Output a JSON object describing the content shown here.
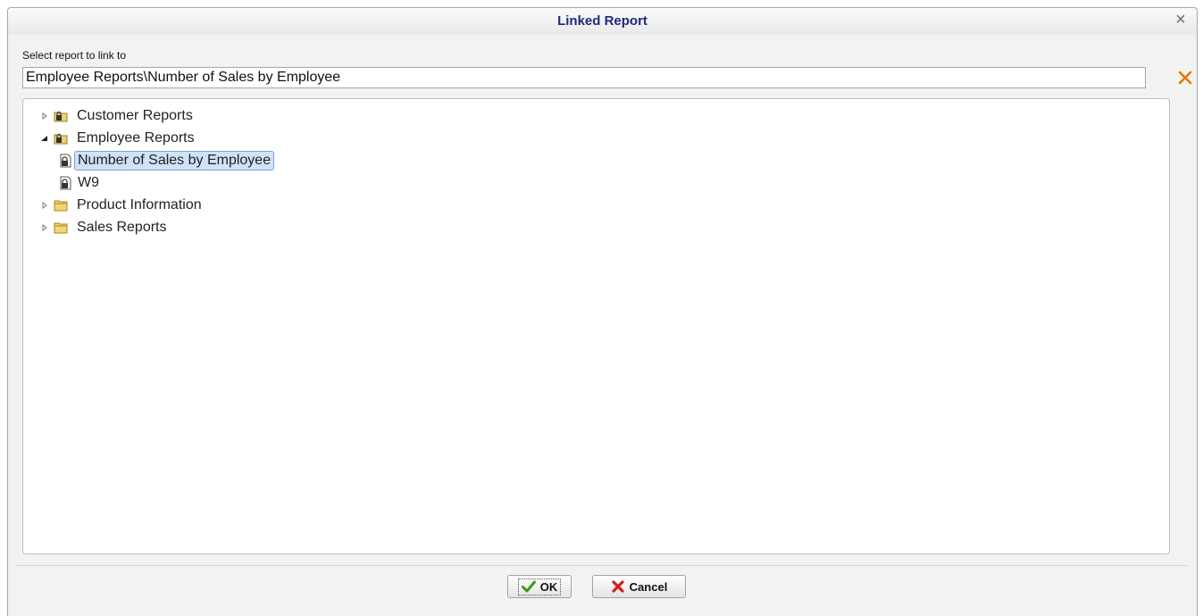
{
  "dialog": {
    "title": "Linked Report",
    "close_icon": "close-icon"
  },
  "form": {
    "label": "Select report to link to",
    "selected_path": "Employee Reports\\Number of Sales by Employee",
    "clear_icon": "clear-x-icon"
  },
  "tree": {
    "items": [
      {
        "label": "Customer Reports",
        "type": "folder-locked",
        "expanded": false
      },
      {
        "label": "Employee Reports",
        "type": "folder-locked",
        "expanded": true
      },
      {
        "label": "Number of Sales by Employee",
        "type": "report-locked",
        "selected": true
      },
      {
        "label": "W9",
        "type": "report-locked",
        "selected": false
      },
      {
        "label": "Product Information",
        "type": "folder",
        "expanded": false
      },
      {
        "label": "Sales Reports",
        "type": "folder",
        "expanded": false
      }
    ]
  },
  "buttons": {
    "ok_label": "OK",
    "cancel_label": "Cancel",
    "ok_icon": "checkmark-icon",
    "cancel_icon": "red-x-icon"
  },
  "colors": {
    "title": "#1f2a7a",
    "selection_bg": "#cfe2f8",
    "selection_border": "#7da2ce",
    "clear_icon": "#e07b00",
    "ok_icon": "#3a9a1a",
    "cancel_icon": "#d0201c"
  }
}
